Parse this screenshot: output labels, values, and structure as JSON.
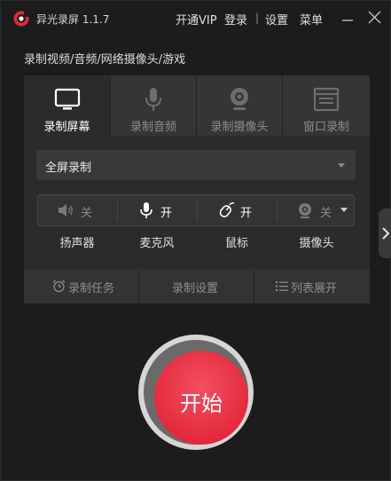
{
  "titlebar": {
    "app_name": "异光录屏 1.1.7",
    "vip": "开通VIP",
    "login": "登录",
    "separator": "|",
    "settings": "设置",
    "menu": "菜单"
  },
  "subtitle": "录制视频/音频/网络摄像头/游戏",
  "tabs": [
    {
      "label": "录制屏幕",
      "icon": "monitor-icon",
      "active": true
    },
    {
      "label": "录制音频",
      "icon": "microphone-icon",
      "active": false
    },
    {
      "label": "录制摄像头",
      "icon": "webcam-icon",
      "active": false
    },
    {
      "label": "窗口录制",
      "icon": "window-icon",
      "active": false
    }
  ],
  "mode_select": {
    "value": "全屏录制"
  },
  "devices": [
    {
      "label": "扬声器",
      "state": "关",
      "icon": "speaker-icon",
      "on": false
    },
    {
      "label": "麦克风",
      "state": "开",
      "icon": "microphone-icon",
      "on": true
    },
    {
      "label": "鼠标",
      "state": "开",
      "icon": "mouse-icon",
      "on": true
    },
    {
      "label": "摄像头",
      "state": "关",
      "icon": "webcam-icon",
      "on": false
    }
  ],
  "bottom_actions": {
    "task": "录制任务",
    "settings": "录制设置",
    "list": "列表展开"
  },
  "start_button": "开始",
  "colors": {
    "background": "#1c1c1c",
    "panel": "#2b2b2b",
    "accent_red": "#e32a3c",
    "text_active": "#ffffff",
    "text_inactive": "#8e8e8e"
  }
}
